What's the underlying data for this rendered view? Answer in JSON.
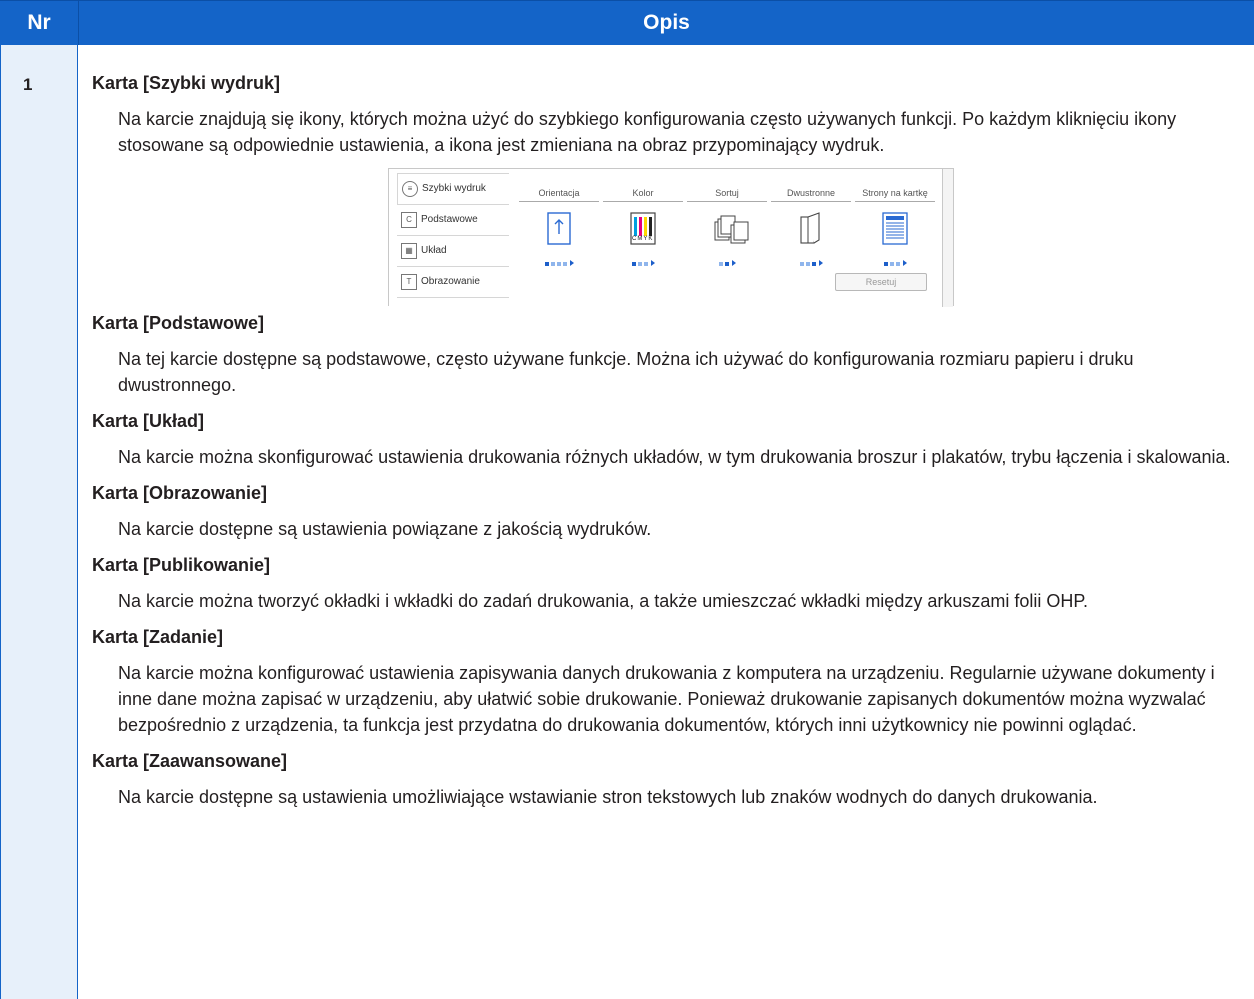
{
  "header": {
    "col_nr": "Nr",
    "col_opis": "Opis"
  },
  "row": {
    "number": "1"
  },
  "screenshot": {
    "tabs": [
      {
        "label": "Szybki wydruk",
        "icon": "quick-print-icon"
      },
      {
        "label": "Podstawowe",
        "icon": "basic-icon"
      },
      {
        "label": "Układ",
        "icon": "layout-icon"
      },
      {
        "label": "Obrazowanie",
        "icon": "imaging-icon"
      }
    ],
    "features": [
      {
        "label": "Orientacja",
        "icon": "orientation-icon"
      },
      {
        "label": "Kolor",
        "icon": "color-icon"
      },
      {
        "label": "Sortuj",
        "icon": "collate-icon"
      },
      {
        "label": "Dwustronne",
        "icon": "duplex-icon"
      },
      {
        "label": "Strony na kartkę",
        "icon": "pages-per-sheet-icon"
      }
    ],
    "color_icon_text": "CMYK",
    "reset_label": "Resetuj"
  },
  "sections": [
    {
      "title": "Karta [Szybki wydruk]",
      "text": "Na karcie znajdują się ikony, których można użyć do szybkiego konfigurowania często używanych funkcji. Po każdym kliknięciu ikony stosowane są odpowiednie ustawienia, a ikona jest zmieniana na obraz przypominający wydruk."
    },
    {
      "title": "Karta [Podstawowe]",
      "text": "Na tej karcie dostępne są podstawowe, często używane funkcje. Można ich używać do konfigurowania rozmiaru papieru i druku dwustronnego."
    },
    {
      "title": "Karta [Układ]",
      "text": "Na karcie można skonfigurować ustawienia drukowania różnych układów, w tym drukowania broszur i plakatów, trybu łączenia i skalowania."
    },
    {
      "title": "Karta [Obrazowanie]",
      "text": "Na karcie dostępne są ustawienia powiązane z jakością wydruków."
    },
    {
      "title": "Karta [Publikowanie]",
      "text": "Na karcie można tworzyć okładki i wkładki do zadań drukowania, a także umieszczać wkładki między arkuszami folii OHP."
    },
    {
      "title": "Karta [Zadanie]",
      "text": "Na karcie można konfigurować ustawienia zapisywania danych drukowania z komputera na urządzeniu. Regularnie używane dokumenty i inne dane można zapisać w urządzeniu, aby ułatwić sobie drukowanie. Ponieważ drukowanie zapisanych dokumentów można wyzwalać bezpośrednio z urządzenia, ta funkcja jest przydatna do drukowania dokumentów, których inni użytkownicy nie powinni oglądać."
    },
    {
      "title": "Karta [Zaawansowane]",
      "text": "Na karcie dostępne są ustawienia umożliwiające wstawianie stron tekstowych lub znaków wodnych do danych drukowania."
    }
  ],
  "colors": {
    "header_bg": "#1464c8",
    "nr_column_bg": "#e7f0fa",
    "accent_blue": "#1d5fca"
  }
}
